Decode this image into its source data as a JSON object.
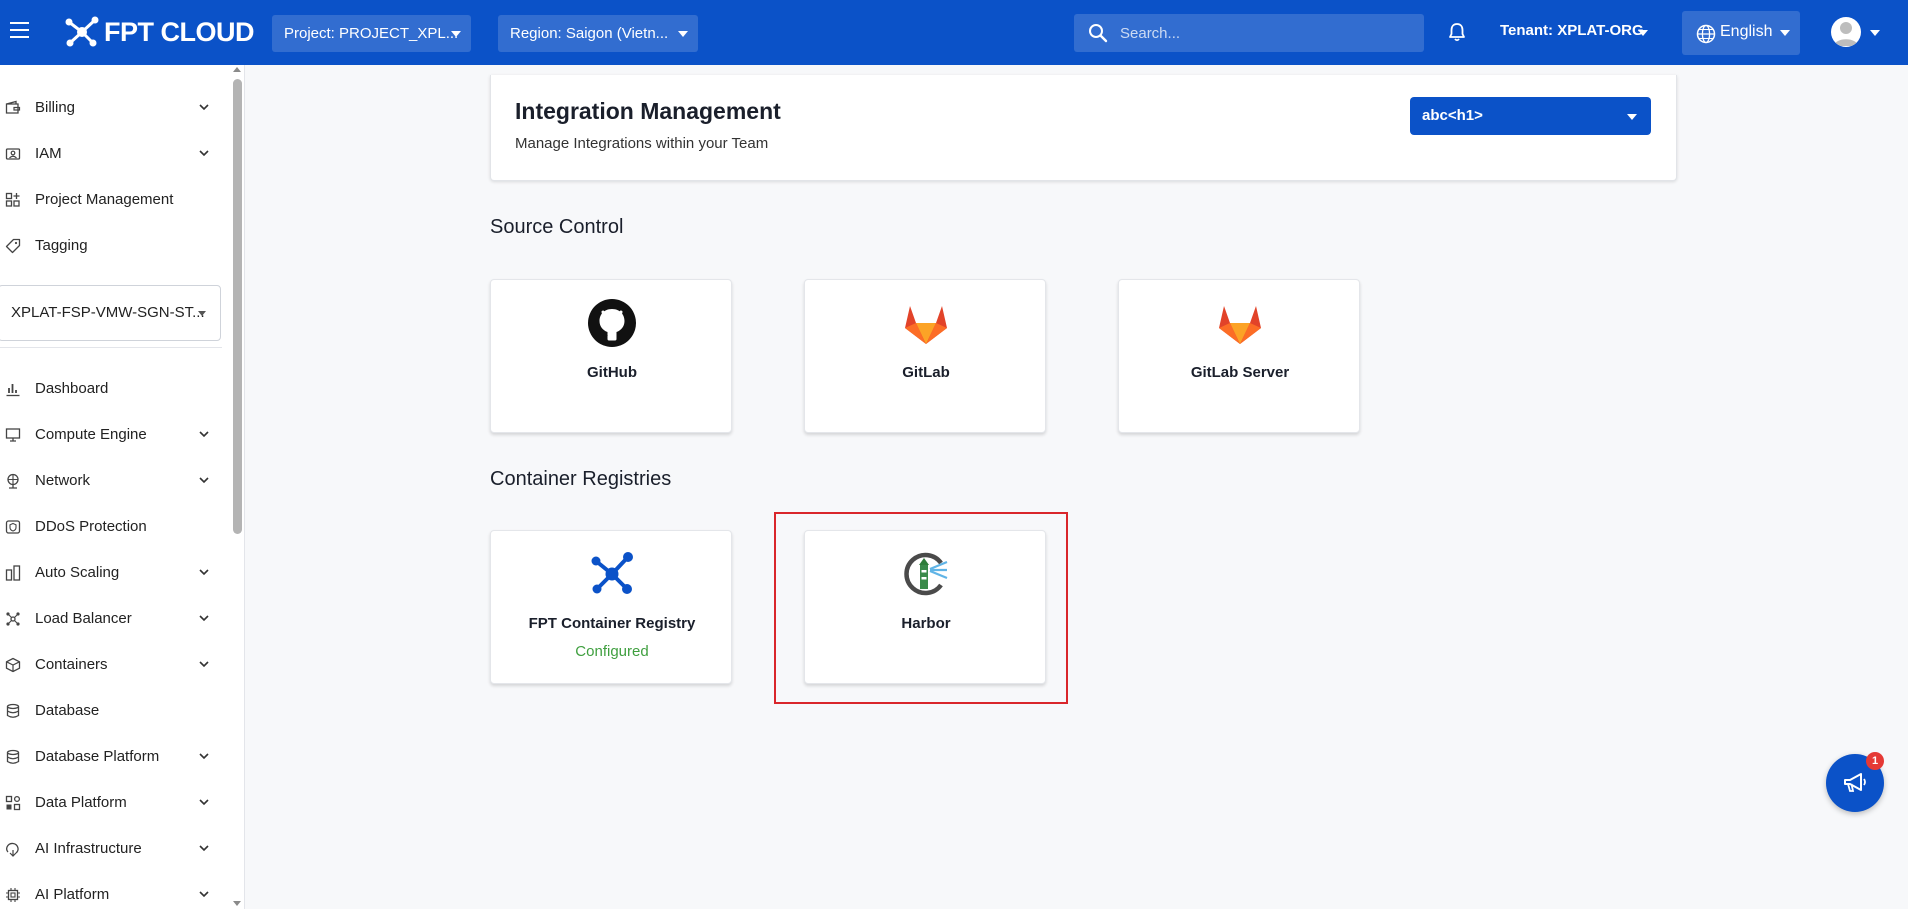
{
  "topbar": {
    "brand": "FPT CLOUD",
    "project_label": "Project: PROJECT_XPL...",
    "region_label": "Region: Saigon (Vietn...",
    "search_placeholder": "Search...",
    "tenant_label": "Tenant: XPLAT-ORG",
    "language_label": "English"
  },
  "sidebar": {
    "top_items": [
      {
        "label": "Billing"
      },
      {
        "label": "IAM"
      },
      {
        "label": "Project Management"
      },
      {
        "label": "Tagging"
      }
    ],
    "project_select": "XPLAT-FSP-VMW-SGN-ST...",
    "items": [
      {
        "label": "Dashboard"
      },
      {
        "label": "Compute Engine"
      },
      {
        "label": "Network"
      },
      {
        "label": "DDoS Protection"
      },
      {
        "label": "Auto Scaling"
      },
      {
        "label": "Load Balancer"
      },
      {
        "label": "Containers"
      },
      {
        "label": "Database"
      },
      {
        "label": "Database Platform"
      },
      {
        "label": "Data Platform"
      },
      {
        "label": "AI Infrastructure"
      },
      {
        "label": "AI Platform"
      }
    ]
  },
  "main": {
    "title": "Integration Management",
    "subtitle": "Manage Integrations within your Team",
    "team_select": "abc<h1>",
    "sections": [
      {
        "title": "Source Control",
        "cards": [
          {
            "name": "GitHub",
            "icon": "github-icon"
          },
          {
            "name": "GitLab",
            "icon": "gitlab-icon"
          },
          {
            "name": "GitLab Server",
            "icon": "gitlab-server-icon"
          }
        ]
      },
      {
        "title": "Container Registries",
        "cards": [
          {
            "name": "FPT Container Registry",
            "icon": "fpt-registry-icon",
            "status": "Configured"
          },
          {
            "name": "Harbor",
            "icon": "harbor-icon"
          }
        ]
      }
    ]
  },
  "fab": {
    "badge": "1"
  },
  "colors": {
    "brand": "#0b52c8",
    "configured": "#3f9f3f",
    "highlight": "#d9262b"
  }
}
